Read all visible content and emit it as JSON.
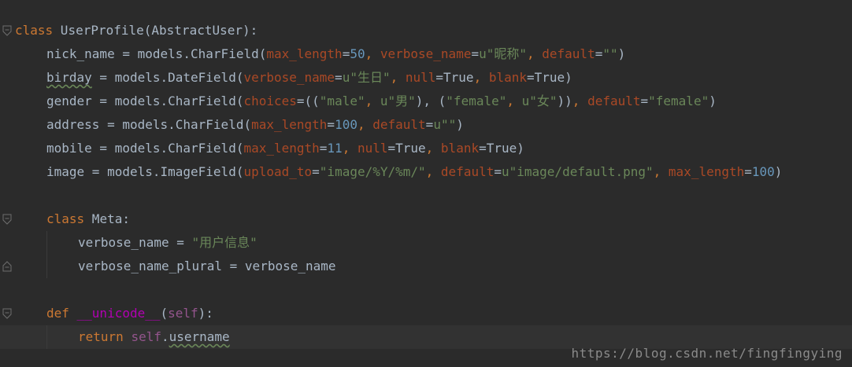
{
  "editor": {
    "lines": [
      {
        "indent": 0,
        "tokens": [
          {
            "t": "class",
            "c": "kw"
          },
          {
            "t": " UserProfile(AbstractUser):",
            "c": ""
          }
        ]
      },
      {
        "indent": 1,
        "tokens": [
          {
            "t": "nick_name = models.CharField(",
            "c": ""
          },
          {
            "t": "max_length",
            "c": "param"
          },
          {
            "t": "=",
            "c": ""
          },
          {
            "t": "50",
            "c": "num"
          },
          {
            "t": ", ",
            "c": "kw"
          },
          {
            "t": "verbose_name",
            "c": "param"
          },
          {
            "t": "=",
            "c": ""
          },
          {
            "t": "u\"昵称\"",
            "c": "str"
          },
          {
            "t": ", ",
            "c": "kw"
          },
          {
            "t": "default",
            "c": "param"
          },
          {
            "t": "=",
            "c": ""
          },
          {
            "t": "\"\"",
            "c": "str"
          },
          {
            "t": ")",
            "c": ""
          }
        ]
      },
      {
        "indent": 1,
        "tokens": [
          {
            "t": "birday",
            "c": "sq"
          },
          {
            "t": " = models.DateField(",
            "c": ""
          },
          {
            "t": "verbose_name",
            "c": "param"
          },
          {
            "t": "=",
            "c": ""
          },
          {
            "t": "u\"生日\"",
            "c": "str"
          },
          {
            "t": ", ",
            "c": "kw"
          },
          {
            "t": "null",
            "c": "param"
          },
          {
            "t": "=True",
            "c": ""
          },
          {
            "t": ", ",
            "c": "kw"
          },
          {
            "t": "blank",
            "c": "param"
          },
          {
            "t": "=True)",
            "c": ""
          }
        ]
      },
      {
        "indent": 1,
        "tokens": [
          {
            "t": "gender = models.CharField(",
            "c": ""
          },
          {
            "t": "choices",
            "c": "param"
          },
          {
            "t": "=((",
            "c": ""
          },
          {
            "t": "\"male\"",
            "c": "str"
          },
          {
            "t": ", ",
            "c": "kw"
          },
          {
            "t": "u\"男\"",
            "c": "str"
          },
          {
            "t": "), (",
            "c": ""
          },
          {
            "t": "\"female\"",
            "c": "str"
          },
          {
            "t": ", ",
            "c": "kw"
          },
          {
            "t": "u\"女\"",
            "c": "str"
          },
          {
            "t": "))",
            "c": ""
          },
          {
            "t": ", ",
            "c": "kw"
          },
          {
            "t": "default",
            "c": "param"
          },
          {
            "t": "=",
            "c": ""
          },
          {
            "t": "\"female\"",
            "c": "str"
          },
          {
            "t": ")",
            "c": ""
          }
        ]
      },
      {
        "indent": 1,
        "tokens": [
          {
            "t": "address = models.CharField(",
            "c": ""
          },
          {
            "t": "max_length",
            "c": "param"
          },
          {
            "t": "=",
            "c": ""
          },
          {
            "t": "100",
            "c": "num"
          },
          {
            "t": ", ",
            "c": "kw"
          },
          {
            "t": "default",
            "c": "param"
          },
          {
            "t": "=",
            "c": ""
          },
          {
            "t": "u\"\"",
            "c": "str"
          },
          {
            "t": ")",
            "c": ""
          }
        ]
      },
      {
        "indent": 1,
        "tokens": [
          {
            "t": "mobile = models.CharField(",
            "c": ""
          },
          {
            "t": "max_length",
            "c": "param"
          },
          {
            "t": "=",
            "c": ""
          },
          {
            "t": "11",
            "c": "num"
          },
          {
            "t": ", ",
            "c": "kw"
          },
          {
            "t": "null",
            "c": "param"
          },
          {
            "t": "=True",
            "c": ""
          },
          {
            "t": ", ",
            "c": "kw"
          },
          {
            "t": "blank",
            "c": "param"
          },
          {
            "t": "=True)",
            "c": ""
          }
        ]
      },
      {
        "indent": 1,
        "tokens": [
          {
            "t": "image = models.ImageField(",
            "c": ""
          },
          {
            "t": "upload_to",
            "c": "param"
          },
          {
            "t": "=",
            "c": ""
          },
          {
            "t": "\"image/%Y/%m/\"",
            "c": "str"
          },
          {
            "t": ", ",
            "c": "kw"
          },
          {
            "t": "default",
            "c": "param"
          },
          {
            "t": "=",
            "c": ""
          },
          {
            "t": "u\"image/default.png\"",
            "c": "str"
          },
          {
            "t": ", ",
            "c": "kw"
          },
          {
            "t": "max_length",
            "c": "param"
          },
          {
            "t": "=",
            "c": ""
          },
          {
            "t": "100",
            "c": "num"
          },
          {
            "t": ")",
            "c": ""
          }
        ]
      },
      {
        "indent": 1,
        "tokens": []
      },
      {
        "indent": 1,
        "tokens": [
          {
            "t": "class",
            "c": "kw"
          },
          {
            "t": " Meta:",
            "c": ""
          }
        ]
      },
      {
        "indent": 2,
        "tokens": [
          {
            "t": "verbose_name = ",
            "c": ""
          },
          {
            "t": "\"用户信息\"",
            "c": "str"
          }
        ]
      },
      {
        "indent": 2,
        "tokens": [
          {
            "t": "verbose_name_plural = verbose_name",
            "c": ""
          }
        ]
      },
      {
        "indent": 1,
        "tokens": []
      },
      {
        "indent": 1,
        "tokens": [
          {
            "t": "def ",
            "c": "kw"
          },
          {
            "t": "__unicode__",
            "c": "dunder"
          },
          {
            "t": "(",
            "c": ""
          },
          {
            "t": "self",
            "c": "selfkw"
          },
          {
            "t": "):",
            "c": ""
          }
        ]
      },
      {
        "indent": 2,
        "current": true,
        "tokens": [
          {
            "t": "return ",
            "c": "kw"
          },
          {
            "t": "self",
            "c": "selfkw"
          },
          {
            "t": ".",
            "c": ""
          },
          {
            "t": "username",
            "c": "sq"
          }
        ]
      }
    ]
  },
  "watermark": "https://blog.csdn.net/fingfingying",
  "colors": {
    "background": "#2b2b2b",
    "default_text": "#a9b7c6",
    "keyword": "#cc7832",
    "parameter": "#aa4926",
    "number": "#6897bb",
    "string": "#6a8759",
    "dunder": "#b200b2",
    "self": "#94558d",
    "current_line": "#323232"
  },
  "gutter_icons": [
    "fold-open-icon",
    "fold-open-icon",
    "fold-close-icon",
    "fold-open-icon",
    "fold-close-icon"
  ]
}
